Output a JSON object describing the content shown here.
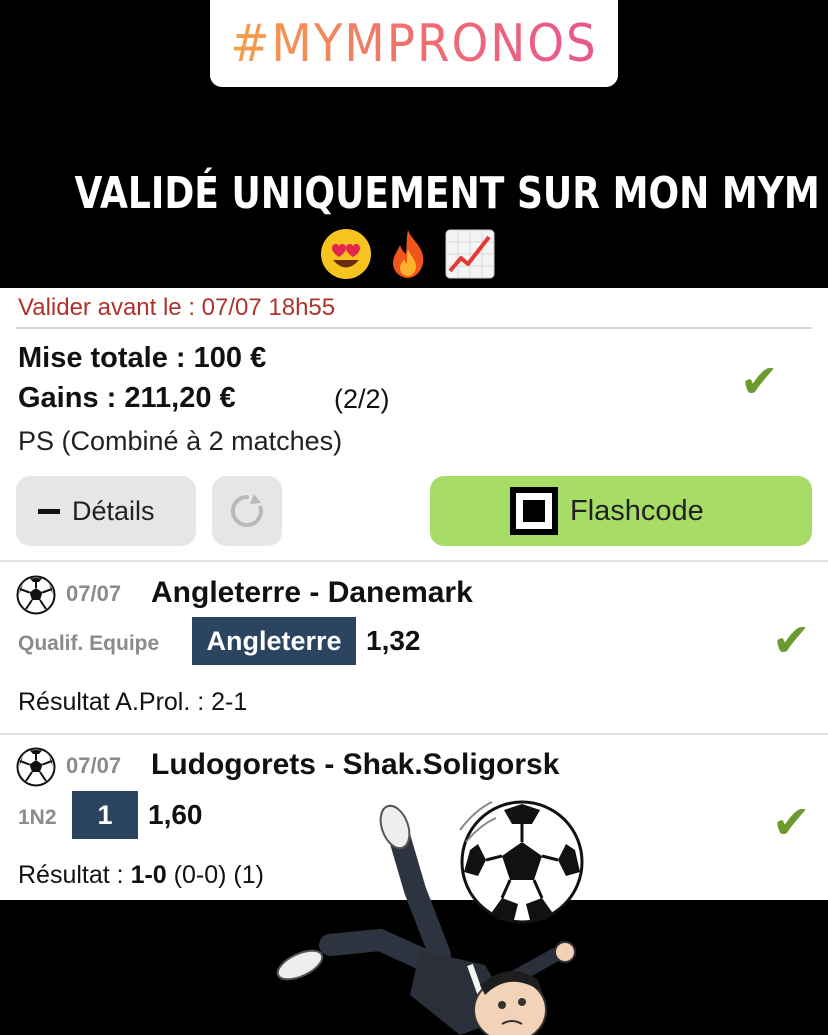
{
  "story": {
    "hashtag": "#MYMPRONOS",
    "headline": "VALIDÉ UNIQUEMENT SUR MON MYM",
    "emojis": [
      "😍",
      "🔥",
      "📈"
    ]
  },
  "ticket": {
    "deadline": "Valider avant le : 07/07 18h55",
    "stake": "Mise totale : 100 €",
    "gains": "Gains : 211,20 €",
    "gains_count": "(2/2)",
    "bet_type": "PS (Combiné à 2 matches)",
    "details_label": "Détails",
    "flashcode_label": "Flashcode",
    "status_color": "#6b9a2e",
    "check_glyph": "✔"
  },
  "matches": [
    {
      "date": "07/07",
      "teams": "Angleterre - Danemark",
      "market": "Qualif. Equipe",
      "pick": "Angleterre",
      "odds": "1,32",
      "result": "Résultat A.Prol. : 2-1",
      "icon": "soccer-ball-icon"
    },
    {
      "date": "07/07",
      "teams": "Ludogorets - Shak.Soligorsk",
      "market": "1N2",
      "pick": "1",
      "odds": "1,60",
      "result_prefix": "Résultat : ",
      "result_score": "1-0",
      "result_suffix": " (0-0) (1)",
      "icon": "soccer-ball-icon"
    }
  ],
  "colors": {
    "deadline": "#b0322a",
    "pick_bg": "#2b4560",
    "flashcode_bg": "#a7dd66",
    "button_bg": "#e6e6e6"
  }
}
